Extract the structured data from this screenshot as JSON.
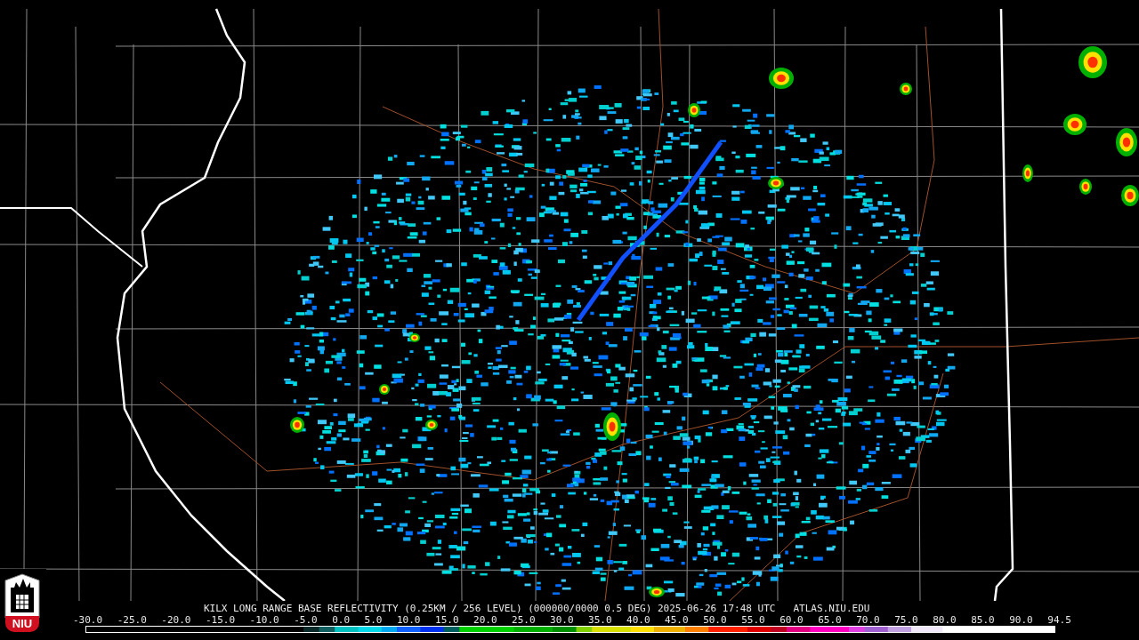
{
  "logo": {
    "text": "NIU"
  },
  "caption": {
    "product": "KILX LONG RANGE BASE REFLECTIVITY (0.25KM / 256 LEVEL) (000000/0000 0.5 DEG) 2025-06-26 17:48 UTC",
    "source": "ATLAS.NIU.EDU"
  },
  "legend": {
    "ticks": [
      "-30.0",
      "-25.0",
      "-20.0",
      "-15.0",
      "-10.0",
      "-5.0",
      "0.0",
      "5.0",
      "10.0",
      "15.0",
      "20.0",
      "25.0",
      "30.0",
      "35.0",
      "40.0",
      "45.0",
      "50.0",
      "55.0",
      "60.0",
      "65.0",
      "70.0",
      "75.0",
      "80.0",
      "85.0",
      "90.0",
      "94.5"
    ]
  }
}
